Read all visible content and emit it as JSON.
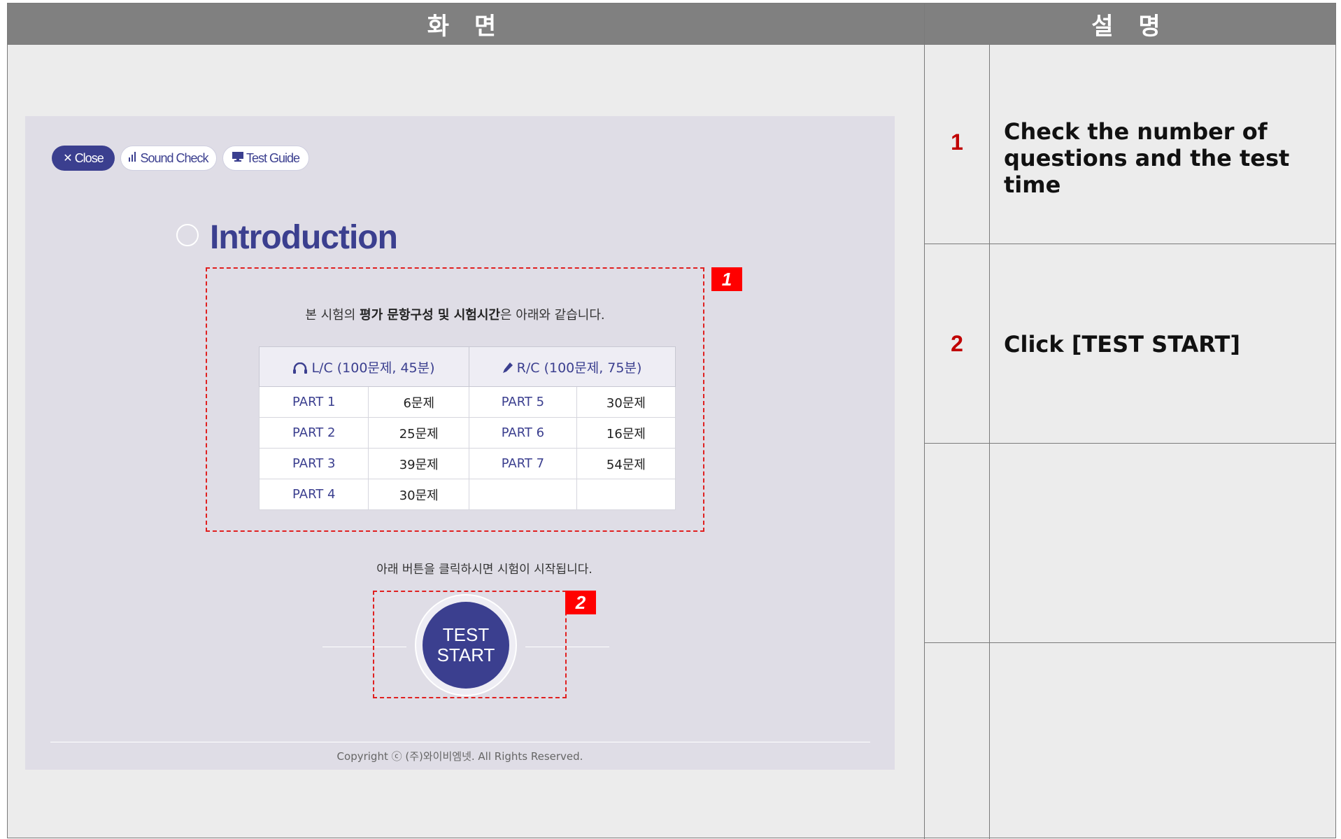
{
  "headers": {
    "screen": "화 면",
    "description": "설 명"
  },
  "app": {
    "buttons": {
      "close": "Close",
      "sound_check": "Sound Check",
      "test_guide": "Test Guide"
    },
    "title": "Introduction",
    "intro_prefix": "본 시험의 ",
    "intro_bold": "평가 문항구성 및 시험시간",
    "intro_suffix": "은 아래와 같습니다.",
    "table": {
      "lc_header": "L/C (100문제, 45분)",
      "rc_header": "R/C (100문제, 75분)",
      "rows": [
        {
          "lc_part": "PART 1",
          "lc_count": "6문제",
          "rc_part": "PART 5",
          "rc_count": "30문제"
        },
        {
          "lc_part": "PART 2",
          "lc_count": "25문제",
          "rc_part": "PART 6",
          "rc_count": "16문제"
        },
        {
          "lc_part": "PART 3",
          "lc_count": "39문제",
          "rc_part": "PART 7",
          "rc_count": "54문제"
        },
        {
          "lc_part": "PART 4",
          "lc_count": "30문제",
          "rc_part": "",
          "rc_count": ""
        }
      ]
    },
    "start_text": "아래 버튼을 클릭하시면 시험이 시작됩니다.",
    "start_button": {
      "line1": "TEST",
      "line2": "START"
    },
    "copyright": "Copyright ⓒ (주)와이비엠넷. All Rights Reserved."
  },
  "badges": [
    "1",
    "2"
  ],
  "descriptions": [
    {
      "number": "1",
      "text": "Check the number of questions and the test time"
    },
    {
      "number": "2",
      "text": "Click [TEST START]"
    }
  ],
  "colors": {
    "accent": "#3b3f8f",
    "header_bg": "#808080",
    "highlight": "#ff0000",
    "number": "#c00000"
  },
  "icons": [
    "close-icon",
    "sound-bars-icon",
    "monitor-icon",
    "headphones-icon",
    "pencil-icon",
    "circle-icon"
  ]
}
